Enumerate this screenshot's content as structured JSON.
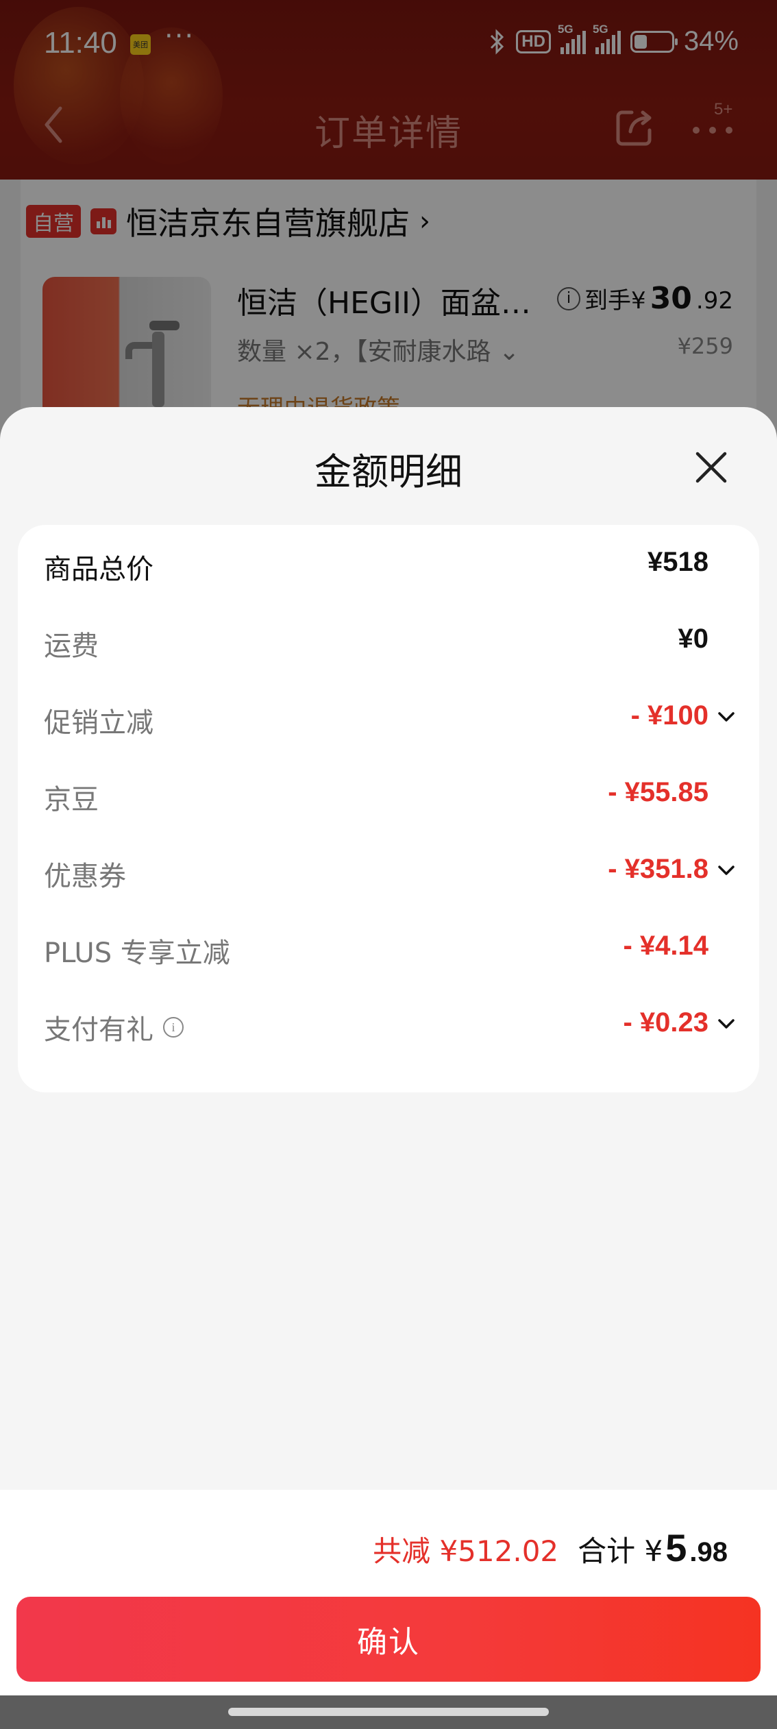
{
  "status_bar": {
    "time": "11:40",
    "app_badge": "美团",
    "more_dots": "···",
    "hd": "HD",
    "net1": "5G",
    "net2": "5G",
    "battery": "34%"
  },
  "nav": {
    "title": "订单详情",
    "badge": "5+"
  },
  "store": {
    "self_tag": "自营",
    "name": "恒洁京东自营旗舰店",
    "chevron": "›"
  },
  "product": {
    "title": "恒洁（HEGII）面盆…",
    "price_prefix": "到手¥",
    "price_int": "30",
    "price_dec": ".92",
    "qty_spec": "数量 ×2，【安耐康水路 ⌄",
    "original_price": "¥259",
    "policy": "无理由退货政策"
  },
  "sheet": {
    "title": "金额明细",
    "rows": [
      {
        "label": "商品总价",
        "value": "¥518",
        "red": false,
        "dropdown": false
      },
      {
        "label": "运费",
        "value": "¥0",
        "red": false,
        "dropdown": false
      },
      {
        "label": "促销立减",
        "value": "- ¥100",
        "red": true,
        "dropdown": true
      },
      {
        "label": "京豆",
        "value": "- ¥55.85",
        "red": true,
        "dropdown": false
      },
      {
        "label": "优惠券",
        "value": "- ¥351.8",
        "red": true,
        "dropdown": true
      },
      {
        "label": "PLUS 专享立减",
        "value": "- ¥4.14",
        "red": true,
        "dropdown": false
      },
      {
        "label": "支付有礼",
        "value": "- ¥0.23",
        "red": true,
        "dropdown": true
      }
    ],
    "info_glyph": "i"
  },
  "footer": {
    "total_reduction": "共减 ¥512.02",
    "total_label": "合计 ¥",
    "total_int": "5",
    "total_dec": ".98",
    "confirm_label": "确认"
  },
  "colors": {
    "accent_red": "#e4302a",
    "header_bg": "#8a1a11",
    "button_start": "#f2384b",
    "button_end": "#f53322"
  }
}
